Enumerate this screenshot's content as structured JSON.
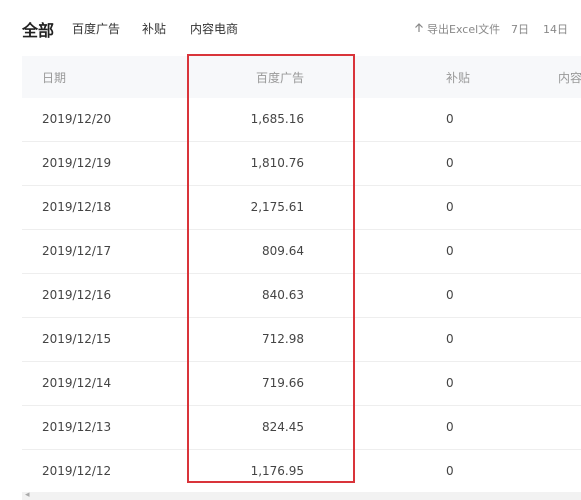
{
  "tabs": [
    {
      "label": "全部",
      "active": true
    },
    {
      "label": "百度广告",
      "active": false
    },
    {
      "label": "补贴",
      "active": false
    },
    {
      "label": "内容电商",
      "active": false
    }
  ],
  "toolbar": {
    "export_label": "导出Excel文件",
    "range_7": "7日",
    "range_14": "14日"
  },
  "table": {
    "headers": [
      "日期",
      "百度广告",
      "补贴",
      "内容"
    ],
    "rows": [
      {
        "date": "2019/12/20",
        "baidu_ads": "1,685.16",
        "subsidy": "0"
      },
      {
        "date": "2019/12/19",
        "baidu_ads": "1,810.76",
        "subsidy": "0"
      },
      {
        "date": "2019/12/18",
        "baidu_ads": "2,175.61",
        "subsidy": "0"
      },
      {
        "date": "2019/12/17",
        "baidu_ads": "809.64",
        "subsidy": "0"
      },
      {
        "date": "2019/12/16",
        "baidu_ads": "840.63",
        "subsidy": "0"
      },
      {
        "date": "2019/12/15",
        "baidu_ads": "712.98",
        "subsidy": "0"
      },
      {
        "date": "2019/12/14",
        "baidu_ads": "719.66",
        "subsidy": "0"
      },
      {
        "date": "2019/12/13",
        "baidu_ads": "824.45",
        "subsidy": "0"
      },
      {
        "date": "2019/12/12",
        "baidu_ads": "1,176.95",
        "subsidy": "0"
      }
    ]
  },
  "colors": {
    "highlight_border": "#d9343a",
    "header_bg": "#f7f8fa",
    "row_divider": "#eeeeee"
  },
  "icons": {
    "export": "upload-arrow-icon"
  }
}
